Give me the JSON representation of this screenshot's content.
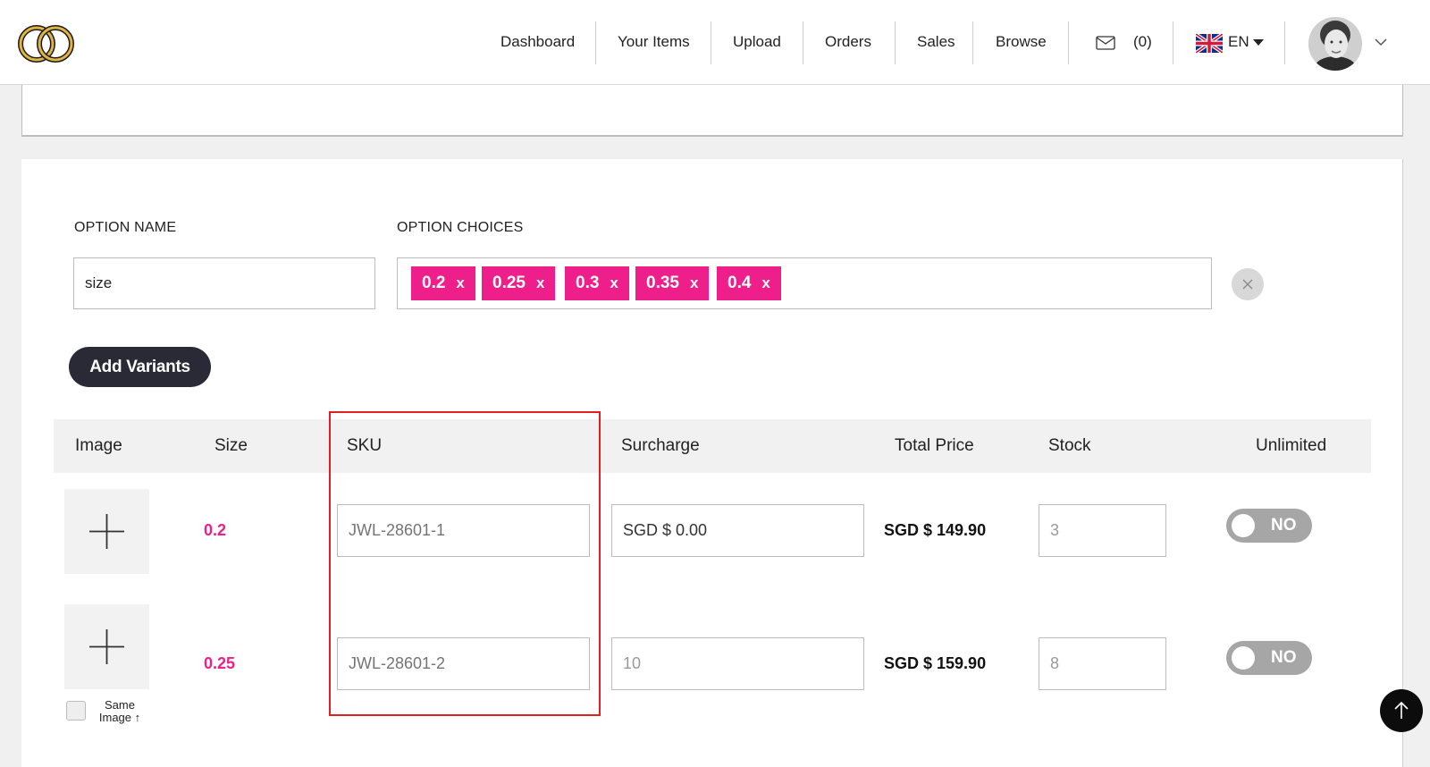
{
  "header": {
    "nav": [
      {
        "label": "Dashboard"
      },
      {
        "label": "Your Items"
      },
      {
        "label": "Upload"
      },
      {
        "label": "Orders"
      },
      {
        "label": "Sales"
      },
      {
        "label": "Browse"
      }
    ],
    "messages_count": "(0)",
    "language": "EN"
  },
  "options": {
    "name_label": "OPTION NAME",
    "choices_label": "OPTION CHOICES",
    "name_value": "size",
    "choices": [
      {
        "label": "0.2",
        "remove": "x"
      },
      {
        "label": "0.25",
        "remove": "x"
      },
      {
        "label": "0.3",
        "remove": "x"
      },
      {
        "label": "0.35",
        "remove": "x"
      },
      {
        "label": "0.4",
        "remove": "x"
      }
    ],
    "add_variants_label": "Add Variants"
  },
  "table": {
    "headers": [
      "Image",
      "Size",
      "SKU",
      "Surcharge",
      "Total Price",
      "Stock",
      "Unlimited"
    ],
    "rows": [
      {
        "size": "0.2",
        "sku_placeholder": "JWL-28601-1",
        "surcharge": "SGD $ 0.00",
        "total_price": "SGD $ 149.90",
        "stock": "3",
        "unlimited": "NO"
      },
      {
        "size": "0.25",
        "sku_placeholder": "JWL-28601-2",
        "surcharge": "10",
        "total_price": "SGD $ 159.90",
        "stock": "8",
        "unlimited": "NO"
      }
    ],
    "same_image_label": "Same Image ↑"
  },
  "colors": {
    "accent_pink": "#ee1f8a",
    "button_dark": "#2a2a36",
    "toggle_off": "#a6a6a6",
    "highlight_red": "#e02020"
  }
}
